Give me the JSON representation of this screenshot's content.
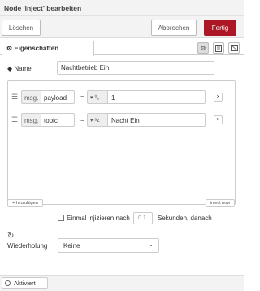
{
  "window": {
    "title": "Node 'inject' bearbeiten"
  },
  "toolbar": {
    "delete_label": "Löschen",
    "cancel_label": "Abbrechen",
    "done_label": "Fertig"
  },
  "tabs": {
    "active_label": "Eigenschaften"
  },
  "name_field": {
    "label": "Name",
    "value": "Nachtbetrieb Ein"
  },
  "properties": [
    {
      "prefix": "msg.",
      "field": "payload",
      "operator": "=",
      "type_glyph": "⁰₉",
      "value": "1"
    },
    {
      "prefix": "msg.",
      "field": "topic",
      "operator": "=",
      "type_glyph": "ᵃz",
      "value": "Nacht Ein"
    }
  ],
  "list_actions": {
    "add_label": "+ hinzufügen",
    "inject_label": "inject now"
  },
  "once": {
    "label_before": "Einmal injizieren nach",
    "delay_value": "0.1",
    "label_after": "Sekunden, danach",
    "checked": false
  },
  "repeat": {
    "label": "Wiederholung",
    "selected": "Keine"
  },
  "footer": {
    "enabled_label": "Aktiviert"
  }
}
